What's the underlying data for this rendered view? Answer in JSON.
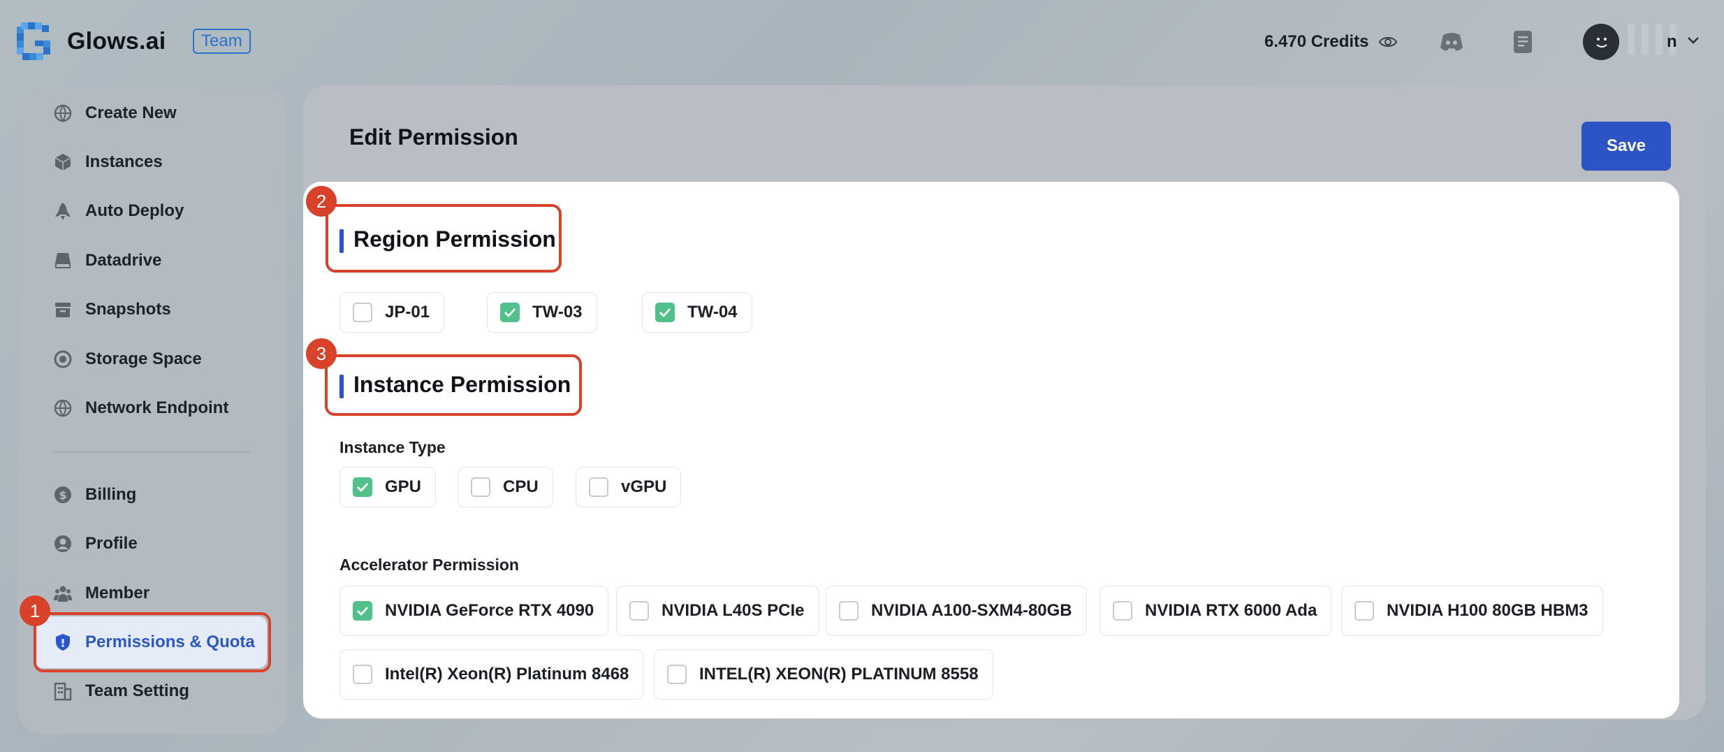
{
  "header": {
    "brand": "Glows.ai",
    "team_tag": "Team",
    "credits": "6.470 Credits",
    "user_name_tail": "n",
    "icons": [
      "logo-icon",
      "eye-icon",
      "discord-icon",
      "document-icon",
      "avatar",
      "chevron-down-icon"
    ]
  },
  "sidebar": {
    "items": [
      {
        "label": "Create New",
        "icon": "globe-icon"
      },
      {
        "label": "Instances",
        "icon": "cube-icon"
      },
      {
        "label": "Auto Deploy",
        "icon": "rocket-icon"
      },
      {
        "label": "Datadrive",
        "icon": "drive-icon"
      },
      {
        "label": "Snapshots",
        "icon": "archive-icon"
      },
      {
        "label": "Storage Space",
        "icon": "storage-icon"
      },
      {
        "label": "Network Endpoint",
        "icon": "network-icon"
      },
      {
        "label": "Billing",
        "icon": "dollar-icon"
      },
      {
        "label": "Profile",
        "icon": "user-icon"
      },
      {
        "label": "Member",
        "icon": "members-icon"
      },
      {
        "label": "Permissions & Quota",
        "icon": "shield-icon",
        "active": true
      },
      {
        "label": "Team Setting",
        "icon": "building-icon"
      }
    ]
  },
  "annotations": {
    "badge_1": "1",
    "badge_2": "2",
    "badge_3": "3",
    "highlight_color": "#d9422a"
  },
  "main": {
    "title": "Edit Permission",
    "save_label": "Save",
    "region": {
      "title": "Region Permission",
      "options": [
        {
          "label": "JP-01",
          "checked": false
        },
        {
          "label": "TW-03",
          "checked": true
        },
        {
          "label": "TW-04",
          "checked": true
        }
      ]
    },
    "instance": {
      "title": "Instance Permission",
      "type_label": "Instance Type",
      "types": [
        {
          "label": "GPU",
          "checked": true
        },
        {
          "label": "CPU",
          "checked": false
        },
        {
          "label": "vGPU",
          "checked": false
        }
      ],
      "accelerator_label": "Accelerator Permission",
      "accelerators": [
        {
          "label": "NVIDIA GeForce RTX 4090",
          "checked": true
        },
        {
          "label": "NVIDIA L40S PCIe",
          "checked": false
        },
        {
          "label": "NVIDIA A100-SXM4-80GB",
          "checked": false
        },
        {
          "label": "NVIDIA RTX 6000 Ada",
          "checked": false
        },
        {
          "label": "NVIDIA H100 80GB HBM3",
          "checked": false
        },
        {
          "label": "Intel(R) Xeon(R) Platinum 8468",
          "checked": false
        },
        {
          "label": "INTEL(R) XEON(R) PLATINUM 8558",
          "checked": false
        }
      ]
    }
  },
  "colors": {
    "accent": "#2d54c4",
    "check": "#52c08a",
    "brand_blue": "#2b72c9"
  }
}
